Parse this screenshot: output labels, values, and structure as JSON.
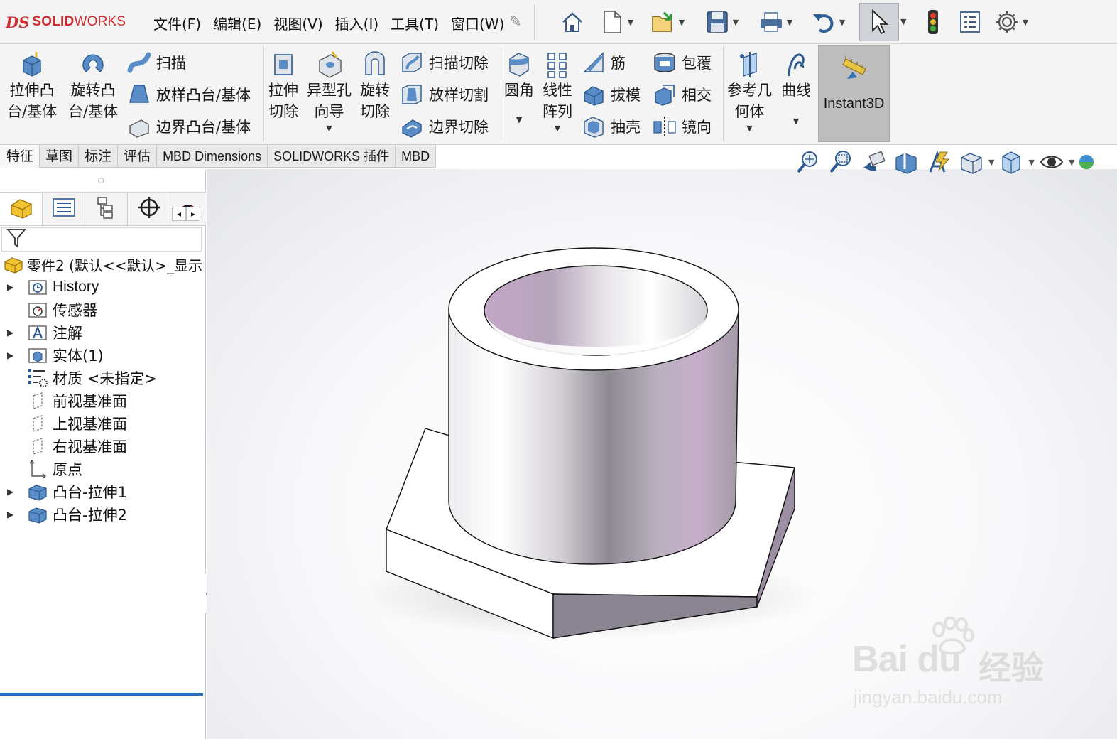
{
  "app": {
    "logo_prefix": "DS",
    "logo_bold": "SOLID",
    "logo_rest": "WORKS"
  },
  "menu": [
    "文件(F)",
    "编辑(E)",
    "视图(V)",
    "插入(I)",
    "工具(T)",
    "窗口(W)"
  ],
  "quick_access": [
    "home-icon",
    "new-document-icon",
    "open-icon",
    "save-icon",
    "print-icon",
    "undo-icon",
    "select-pointer-icon",
    "rebuild-traffic-light-icon",
    "file-properties-icon",
    "options-gear-icon"
  ],
  "ribbon": {
    "extruded_boss": {
      "line1": "拉伸凸",
      "line2": "台/基体"
    },
    "revolved_boss": {
      "line1": "旋转凸",
      "line2": "台/基体"
    },
    "sweep": "扫描",
    "loft": "放样凸台/基体",
    "boundary": "边界凸台/基体",
    "extruded_cut": {
      "line1": "拉伸",
      "line2": "切除"
    },
    "hole_wizard": {
      "line1": "异型孔",
      "line2": "向导"
    },
    "revolved_cut": {
      "line1": "旋转",
      "line2": "切除"
    },
    "swept_cut": "扫描切除",
    "lofted_cut": "放样切割",
    "boundary_cut": "边界切除",
    "fillet": "圆角",
    "linear_pattern": {
      "line1": "线性",
      "line2": "阵列"
    },
    "rib": "筋",
    "draft": "拔模",
    "shell": "抽壳",
    "wrap": "包覆",
    "intersect": "相交",
    "mirror": "镜向",
    "ref_geometry": {
      "line1": "参考几",
      "line2": "何体"
    },
    "curves": "曲线",
    "instant3d": "Instant3D"
  },
  "tabs": [
    "特征",
    "草图",
    "标注",
    "评估",
    "MBD Dimensions",
    "SOLIDWORKS 插件",
    "MBD"
  ],
  "active_tab": "特征",
  "hud_icons": [
    "zoom-to-fit-icon",
    "zoom-area-icon",
    "previous-view-icon",
    "section-view-icon",
    "dynamic-annotation-icon",
    "view-orientation-icon",
    "display-style-icon",
    "hide-show-icon",
    "appearance-icon"
  ],
  "feature_tree": {
    "root": "零件2  (默认<<默认>_显示",
    "items": [
      {
        "label": "History",
        "expandable": true,
        "icon": "history-folder-icon"
      },
      {
        "label": "传感器",
        "expandable": false,
        "icon": "sensors-icon"
      },
      {
        "label": "注解",
        "expandable": true,
        "icon": "annotations-icon"
      },
      {
        "label": "实体(1)",
        "expandable": true,
        "icon": "solid-bodies-icon"
      },
      {
        "label": "材质 <未指定>",
        "expandable": false,
        "icon": "material-icon"
      },
      {
        "label": "前视基准面",
        "expandable": false,
        "icon": "plane-icon"
      },
      {
        "label": "上视基准面",
        "expandable": false,
        "icon": "plane-icon"
      },
      {
        "label": "右视基准面",
        "expandable": false,
        "icon": "plane-icon"
      },
      {
        "label": "原点",
        "expandable": false,
        "icon": "origin-icon"
      },
      {
        "label": "凸台-拉伸1",
        "expandable": true,
        "icon": "extrude-feature-icon"
      },
      {
        "label": "凸台-拉伸2",
        "expandable": true,
        "icon": "extrude-feature-icon"
      }
    ]
  },
  "watermark": {
    "brand": "Bai  du",
    "cn": "经验",
    "url": "jingyan.baidu.com"
  },
  "colors": {
    "brand_red": "#d12a2f",
    "accent_blue": "#1f6fc0",
    "model_shade": "#c8b4cc"
  }
}
